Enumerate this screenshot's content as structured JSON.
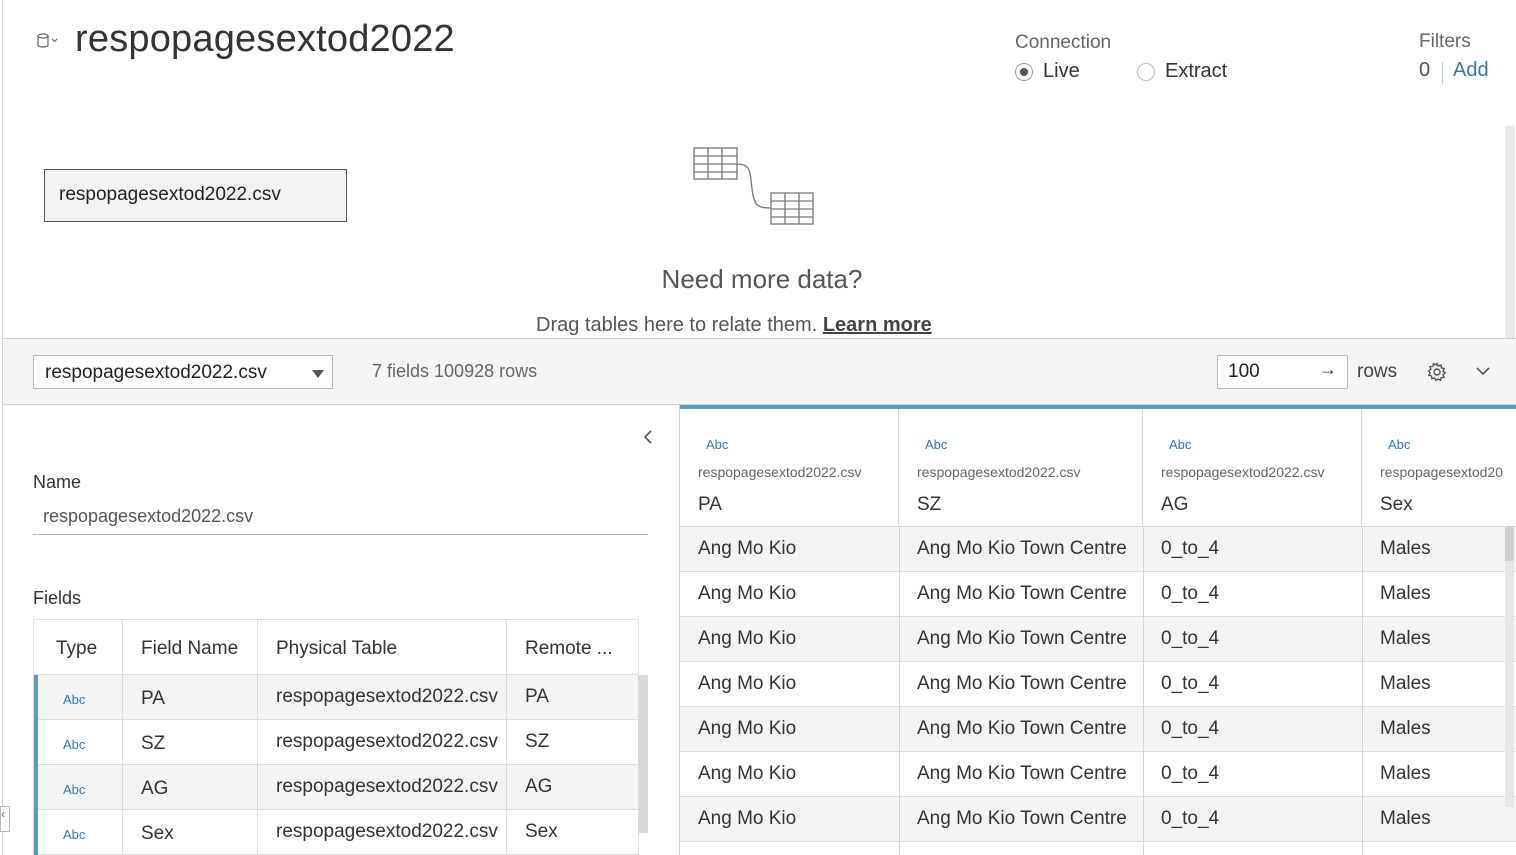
{
  "datasource": {
    "title": "respopagesextod2022",
    "icon": "database-icon"
  },
  "connection": {
    "label": "Connection",
    "options": [
      "Live",
      "Extract"
    ],
    "selected": "Live"
  },
  "filters": {
    "label": "Filters",
    "count": "0",
    "add_label": "Add"
  },
  "canvas": {
    "table_node": "respopagesextod2022.csv",
    "need_more": "Need more data?",
    "drag_text": "Drag tables here to relate them.",
    "learn_more": "Learn more"
  },
  "toolbar": {
    "table_select": "respopagesextod2022.csv",
    "summary": "7 fields 100928 rows",
    "rows_value": "100",
    "rows_arrow": "→",
    "rows_label": "rows"
  },
  "details": {
    "name_label": "Name",
    "name_value": "respopagesextod2022.csv",
    "fields_label": "Fields",
    "fields_columns": [
      "Type",
      "Field Name",
      "Physical Table",
      "Remote ..."
    ],
    "fields": [
      {
        "type": "Abc",
        "name": "PA",
        "table": "respopagesextod2022.csv",
        "remote": "PA"
      },
      {
        "type": "Abc",
        "name": "SZ",
        "table": "respopagesextod2022.csv",
        "remote": "SZ"
      },
      {
        "type": "Abc",
        "name": "AG",
        "table": "respopagesextod2022.csv",
        "remote": "AG"
      },
      {
        "type": "Abc",
        "name": "Sex",
        "table": "respopagesextod2022.csv",
        "remote": "Sex"
      }
    ]
  },
  "grid": {
    "columns": [
      {
        "type": "Abc",
        "source": "respopagesextod2022.csv",
        "name": "PA"
      },
      {
        "type": "Abc",
        "source": "respopagesextod2022.csv",
        "name": "SZ"
      },
      {
        "type": "Abc",
        "source": "respopagesextod2022.csv",
        "name": "AG"
      },
      {
        "type": "Abc",
        "source": "respopagesextod20",
        "name": "Sex"
      }
    ],
    "rows": [
      [
        "Ang Mo Kio",
        "Ang Mo Kio Town Centre",
        "0_to_4",
        "Males"
      ],
      [
        "Ang Mo Kio",
        "Ang Mo Kio Town Centre",
        "0_to_4",
        "Males"
      ],
      [
        "Ang Mo Kio",
        "Ang Mo Kio Town Centre",
        "0_to_4",
        "Males"
      ],
      [
        "Ang Mo Kio",
        "Ang Mo Kio Town Centre",
        "0_to_4",
        "Males"
      ],
      [
        "Ang Mo Kio",
        "Ang Mo Kio Town Centre",
        "0_to_4",
        "Males"
      ],
      [
        "Ang Mo Kio",
        "Ang Mo Kio Town Centre",
        "0_to_4",
        "Males"
      ],
      [
        "Ang Mo Kio",
        "Ang Mo Kio Town Centre",
        "0_to_4",
        "Males"
      ]
    ]
  },
  "edge_mark": "‹",
  "colors": {
    "accent": "#5a9cba",
    "link": "#2b7bb8",
    "type_icon": "#2b7bb8"
  }
}
